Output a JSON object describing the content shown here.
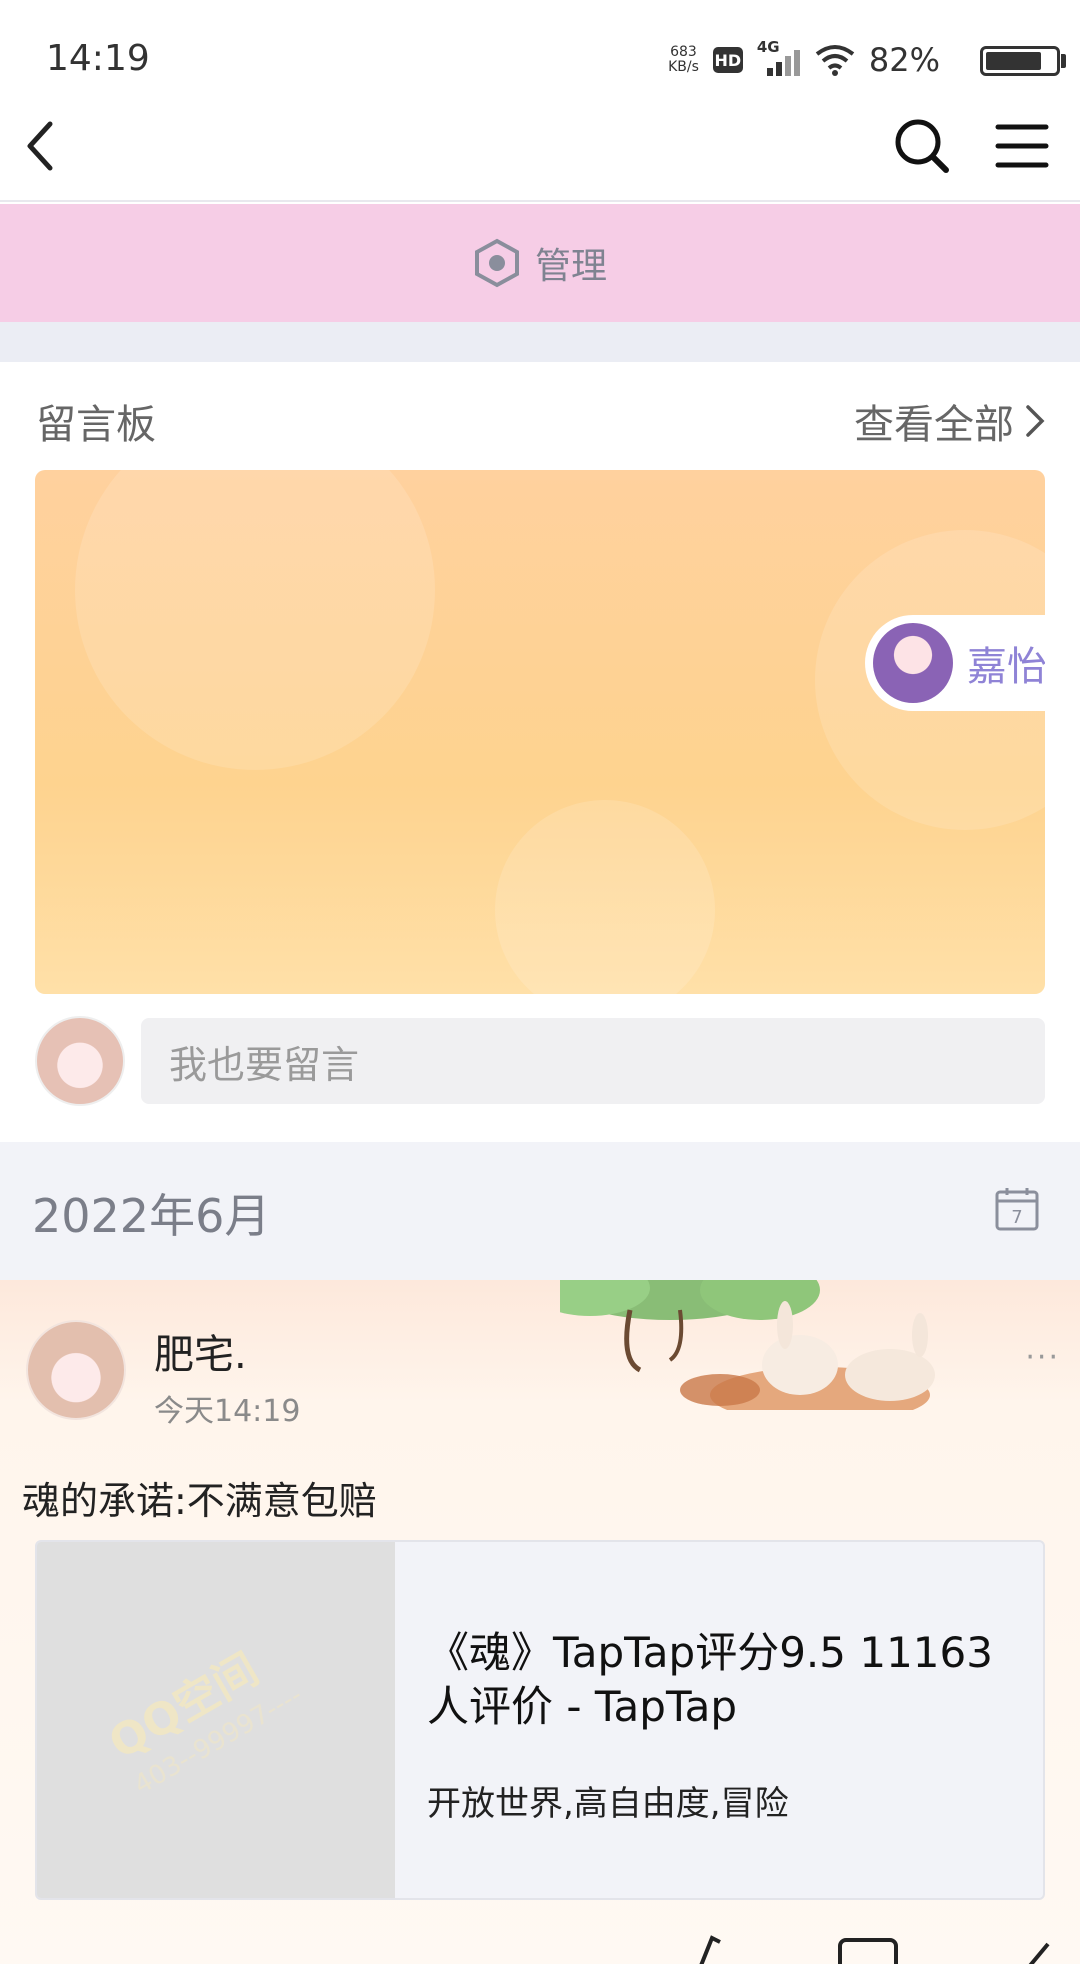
{
  "status_bar": {
    "time": "14:19",
    "net_speed_value": "683",
    "net_speed_unit": "KB/s",
    "hd_badge": "HD",
    "network_type": "4G",
    "battery_percent": "82%",
    "battery_level": 0.82
  },
  "nav": {
    "back_icon": "chevron-left-icon",
    "search_icon": "search-icon",
    "menu_icon": "menu-icon"
  },
  "manage": {
    "label": "管理",
    "icon": "hexagon-settings-icon"
  },
  "message_board": {
    "title": "留言板",
    "view_all": "查看全部",
    "visitor_name": "嘉怡",
    "comment_placeholder": "我也要留言"
  },
  "timeline": {
    "month": "2022年6月"
  },
  "post": {
    "author": "肥宅.",
    "time": "今天14:19",
    "more": "···",
    "text": "魂的承诺:不满意包赔",
    "share": {
      "title": "《魂》TapTap评分9.5 11163人评价 - TapTap",
      "description": "开放世界,高自由度,冒险",
      "watermark_title": "QQ空间",
      "watermark_sub": "403--99997----"
    }
  },
  "colors": {
    "banner_bg": "#f6cde6",
    "board_bg": "#fed38f",
    "visitor_name": "#8f83d6"
  }
}
